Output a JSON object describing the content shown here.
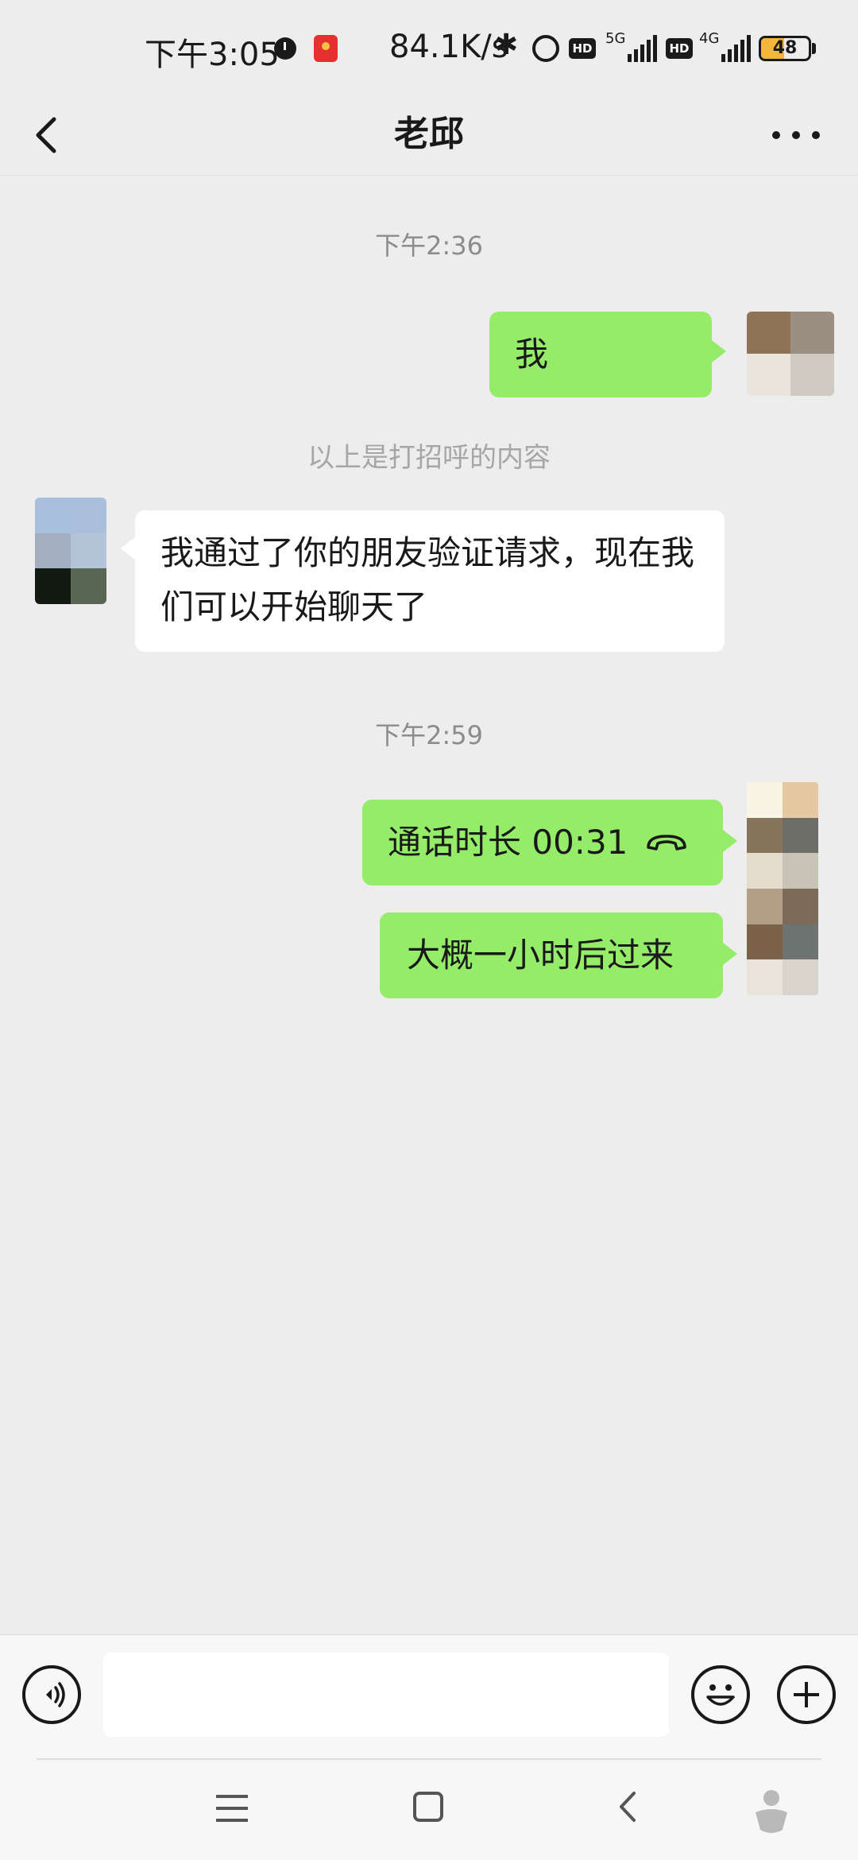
{
  "status_bar": {
    "time": "下午3:05",
    "speed": "84.1K/s",
    "hd_label": "HD",
    "net1": "5G",
    "net2": "4G",
    "battery": "48",
    "battery_level": 0.48
  },
  "header": {
    "title": "老邱"
  },
  "chat": {
    "timestamp1": "下午2:36",
    "sent_greeting": "我",
    "system_note": "以上是打招呼的内容",
    "received_msg": "我通过了你的朋友验证请求，现在我们可以开始聊天了",
    "timestamp2": "下午2:59",
    "call_msg": "通话时长 00:31",
    "sent_msg2": "大概一小时后过来"
  },
  "colors": {
    "bubble_sent": "#95ec69",
    "bubble_received": "#ffffff",
    "background": "#ededed"
  },
  "icons": {
    "back": "chevron-left-icon",
    "more": "more-icon",
    "voice": "voice-icon",
    "emoji": "emoji-icon",
    "add": "plus-icon",
    "phone": "phone-icon"
  }
}
